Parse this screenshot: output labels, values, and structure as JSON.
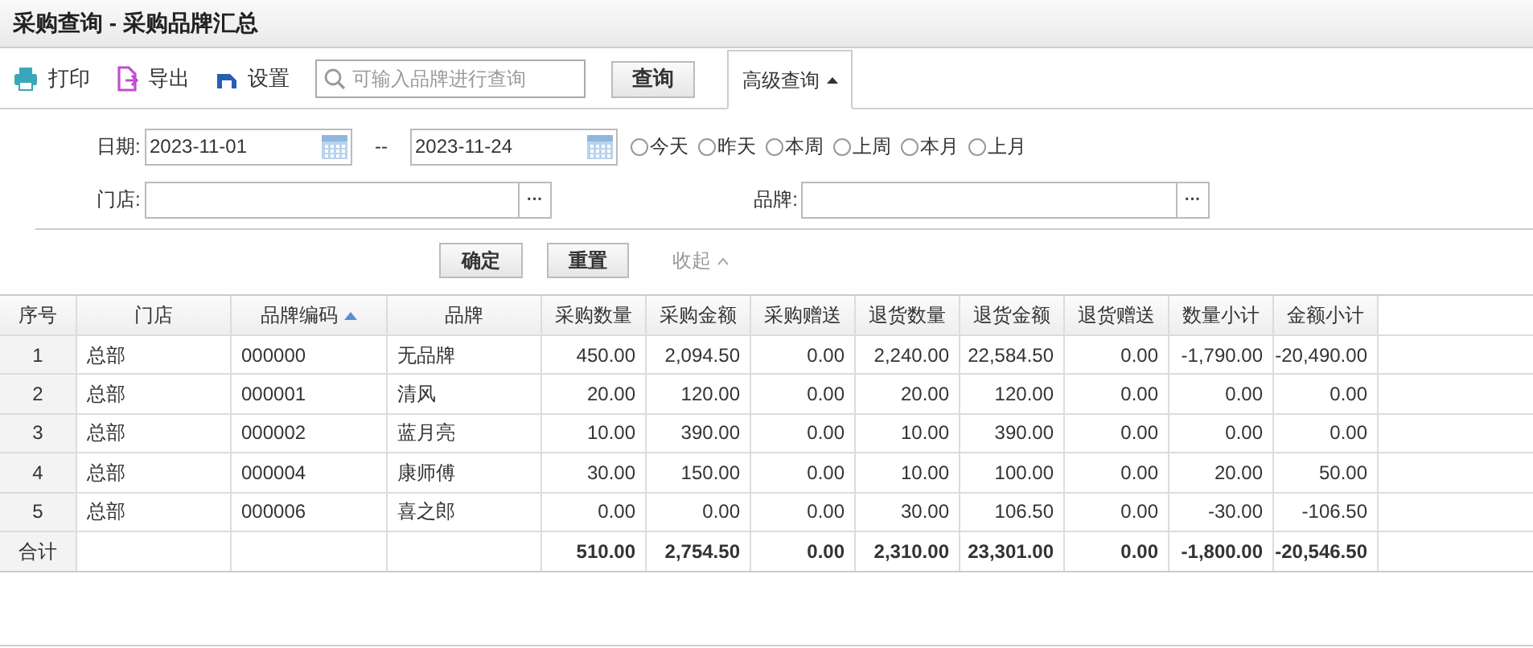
{
  "window": {
    "title": "采购查询 - 采购品牌汇总"
  },
  "toolbar": {
    "buttons": [
      {
        "label": "打印",
        "kind": "print"
      },
      {
        "label": "导出",
        "kind": "export"
      },
      {
        "label": "设置",
        "kind": "settings"
      }
    ],
    "search": {
      "placeholder": "可输入品牌进行查询"
    },
    "search_button": "查询",
    "advanced_tab": {
      "label": "高级查询",
      "expanded": true
    }
  },
  "filters": {
    "date_label": "日期:",
    "date_from": "2023-11-01",
    "separator": "--",
    "date_to": "2023-11-24",
    "ranges": [
      {
        "label": "今天",
        "selected": false
      },
      {
        "label": "昨天",
        "selected": false
      },
      {
        "label": "本周",
        "selected": false
      },
      {
        "label": "上周",
        "selected": false
      },
      {
        "label": "本月",
        "selected": false
      },
      {
        "label": "上月",
        "selected": false
      }
    ],
    "store_label": "门店:",
    "store_button": "···",
    "brand_label": "品牌:",
    "brand_button": "···",
    "confirm": "确定",
    "reset": "重置",
    "collapse": "收起"
  },
  "table": {
    "columns": [
      {
        "label": "序号"
      },
      {
        "label": "门店"
      },
      {
        "label": "品牌编码",
        "sorted": true
      },
      {
        "label": "品牌"
      },
      {
        "label": "采购数量"
      },
      {
        "label": "采购金额"
      },
      {
        "label": "采购赠送"
      },
      {
        "label": "退货数量"
      },
      {
        "label": "退货金额"
      },
      {
        "label": "退货赠送"
      },
      {
        "label": "数量小计"
      },
      {
        "label": "金额小计"
      }
    ],
    "rows": [
      [
        "1",
        "总部",
        "000000",
        "无品牌",
        "450.00",
        "2,094.50",
        "0.00",
        "2,240.00",
        "22,584.50",
        "0.00",
        "-1,790.00",
        "-20,490.00"
      ],
      [
        "2",
        "总部",
        "000001",
        "清风",
        "20.00",
        "120.00",
        "0.00",
        "20.00",
        "120.00",
        "0.00",
        "0.00",
        "0.00"
      ],
      [
        "3",
        "总部",
        "000002",
        "蓝月亮",
        "10.00",
        "390.00",
        "0.00",
        "10.00",
        "390.00",
        "0.00",
        "0.00",
        "0.00"
      ],
      [
        "4",
        "总部",
        "000004",
        "康师傅",
        "30.00",
        "150.00",
        "0.00",
        "10.00",
        "100.00",
        "0.00",
        "20.00",
        "50.00"
      ],
      [
        "5",
        "总部",
        "000006",
        "喜之郎",
        "0.00",
        "0.00",
        "0.00",
        "30.00",
        "106.50",
        "0.00",
        "-30.00",
        "-106.50"
      ]
    ],
    "total": {
      "label": "合计",
      "values": [
        "510.00",
        "2,754.50",
        "0.00",
        "2,310.00",
        "23,301.00",
        "0.00",
        "-1,800.00",
        "-20,546.50"
      ]
    }
  }
}
